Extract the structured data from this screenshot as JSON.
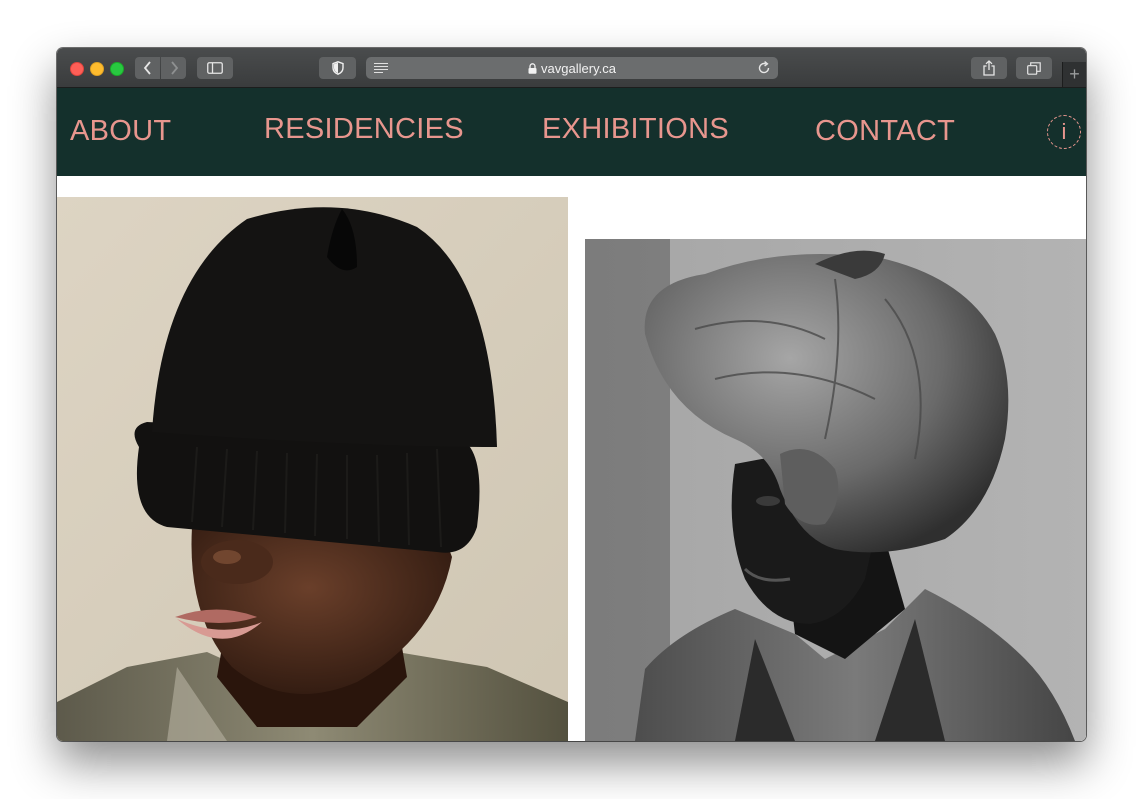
{
  "browser": {
    "url": "vavgallery.ca",
    "plus": "+"
  },
  "site": {
    "nav": [
      {
        "label": "ABOUT"
      },
      {
        "label": "RESIDENCIES"
      },
      {
        "label": "EXHIBITIONS"
      },
      {
        "label": "CONTACT"
      }
    ],
    "info_label": "i",
    "colors": {
      "nav_bg": "#14302c",
      "nav_text": "#e8968e"
    }
  },
  "gallery": {
    "images": [
      {
        "icon": "portrait-black-beanie-photo"
      },
      {
        "icon": "portrait-head-wrap-bw-photo"
      }
    ]
  }
}
